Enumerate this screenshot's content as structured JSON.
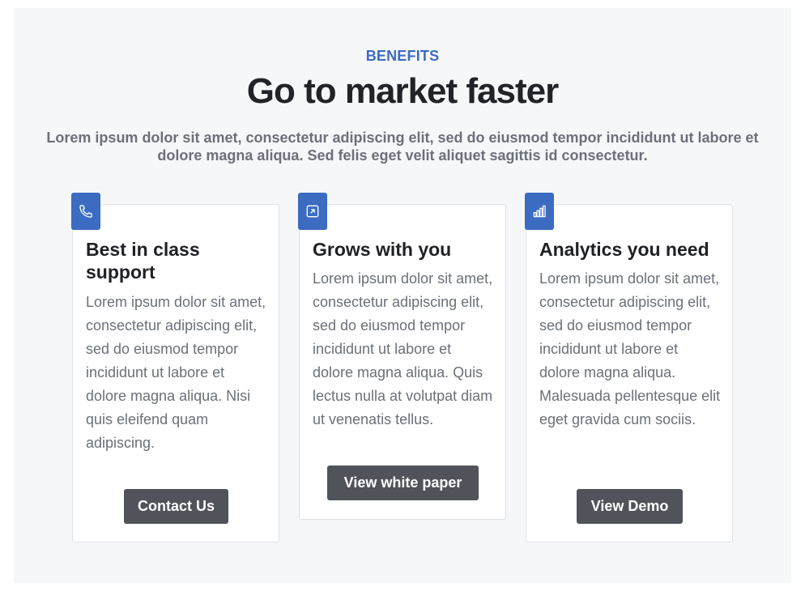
{
  "header": {
    "eyebrow": "BENEFITS",
    "title": "Go to market faster",
    "subtitle": "Lorem ipsum dolor sit amet, consectetur adipiscing elit, sed do eiusmod tempor incididunt ut labore et dolore magna aliqua. Sed felis eget velit aliquet sagittis id consectetur."
  },
  "colors": {
    "accent": "#3b6cc2",
    "button": "#51535a",
    "background": "#f6f7f9"
  },
  "cards": [
    {
      "icon": "phone-icon",
      "title": "Best in class support",
      "text": "Lorem ipsum dolor sit amet, consectetur adipiscing elit, sed do eiusmod tempor incididunt ut labore et dolore magna aliqua. Nisi quis eleifend quam adipiscing.",
      "button": "Contact Us"
    },
    {
      "icon": "external-link-icon",
      "title": "Grows with you",
      "text": "Lorem ipsum dolor sit amet, consectetur adipiscing elit, sed do eiusmod tempor incididunt ut labore et dolore magna aliqua. Quis lectus nulla at volutpat diam ut venenatis tellus.",
      "button": "View white paper"
    },
    {
      "icon": "bar-chart-icon",
      "title": "Analytics you need",
      "text": "Lorem ipsum dolor sit amet, consectetur adipiscing elit, sed do eiusmod tempor incididunt ut labore et dolore magna aliqua. Malesuada pellentesque elit eget gravida cum sociis.",
      "button": "View Demo"
    }
  ]
}
